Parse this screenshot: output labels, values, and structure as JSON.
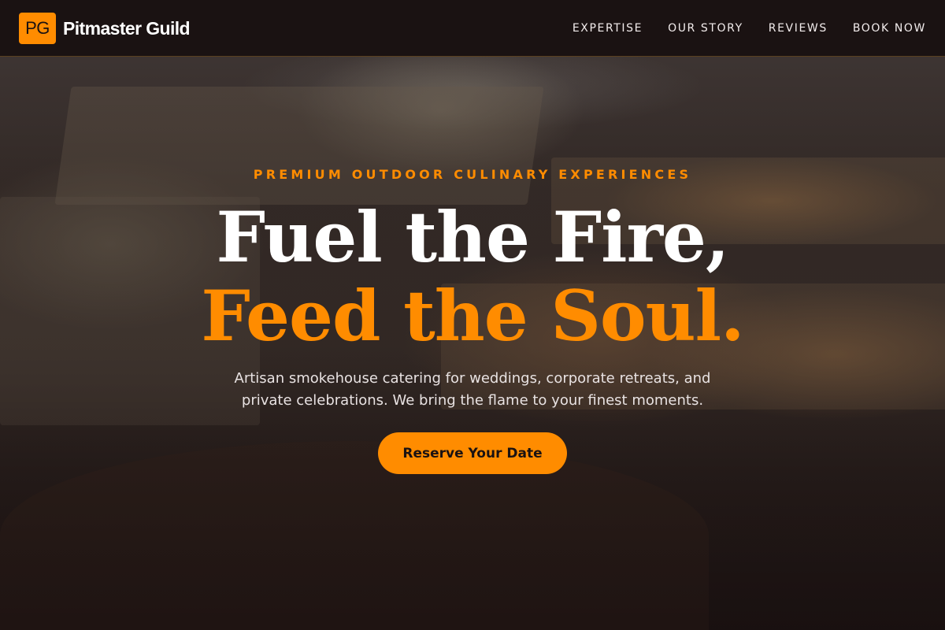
{
  "brand": {
    "badge": "PG",
    "name": "Pitmaster Guild"
  },
  "nav": {
    "items": [
      {
        "label": "EXPERTISE"
      },
      {
        "label": "OUR STORY"
      },
      {
        "label": "REVIEWS"
      },
      {
        "label": "BOOK NOW"
      }
    ]
  },
  "hero": {
    "eyebrow": "PREMIUM OUTDOOR CULINARY EXPERIENCES",
    "title_line1": "Fuel the Fire,",
    "title_line2": "Feed the Soul.",
    "subtitle": "Artisan smokehouse catering for weddings, corporate retreats, and private celebrations. We bring the flame to your finest moments.",
    "cta_label": "Reserve Your Date"
  },
  "colors": {
    "accent": "#ff8c00",
    "header_bg": "#1a1212",
    "text_light": "#ffffff"
  }
}
